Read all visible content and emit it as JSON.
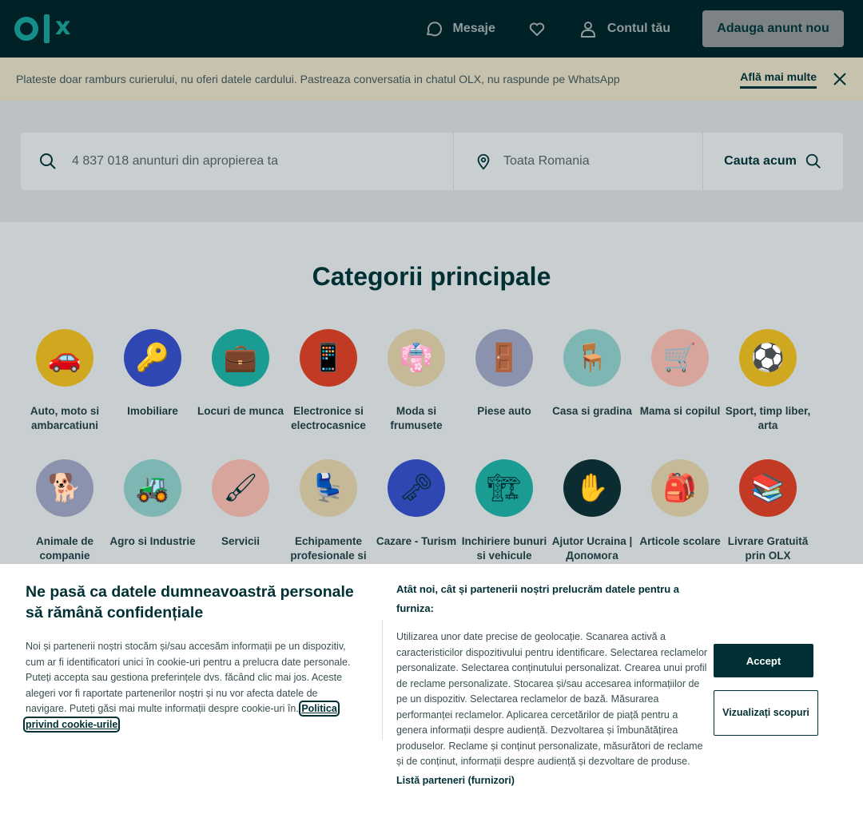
{
  "header": {
    "messages_label": "Mesaje",
    "account_label": "Contul tău",
    "post_ad_label": "Adauga anunt nou"
  },
  "banner": {
    "text": "Plateste doar ramburs curierului, nu oferi datele cardului. Pastreaza conversatia in chatul OLX, nu raspunde pe WhatsApp",
    "link": "Află mai multe"
  },
  "search": {
    "placeholder": "4 837 018 anunturi din apropierea ta",
    "location": "Toata Romania",
    "button": "Cauta acum"
  },
  "categories": {
    "title": "Categorii principale",
    "items": [
      {
        "label": "Auto, moto si ambarcatiuni",
        "color": "#cfa81f",
        "icon": "🚗"
      },
      {
        "label": "Imobiliare",
        "color": "#2f47b3",
        "icon": "🔑"
      },
      {
        "label": "Locuri de munca",
        "color": "#1b9c92",
        "icon": "💼"
      },
      {
        "label": "Electronice si electrocasnice",
        "color": "#c23a23",
        "icon": "📱"
      },
      {
        "label": "Moda si frumusete",
        "color": "#c6b997",
        "icon": "👘"
      },
      {
        "label": "Piese auto",
        "color": "#8b92ad",
        "icon": "🚪"
      },
      {
        "label": "Casa si gradina",
        "color": "#7eb6b4",
        "icon": "🪑"
      },
      {
        "label": "Mama si copilul",
        "color": "#d7a59b",
        "icon": "🛒"
      },
      {
        "label": "Sport, timp liber, arta",
        "color": "#cfa81f",
        "icon": "⚽"
      },
      {
        "label": "Animale de companie",
        "color": "#8b92ad",
        "icon": "🐕"
      },
      {
        "label": "Agro si Industrie",
        "color": "#7eb6b4",
        "icon": "🚜"
      },
      {
        "label": "Servicii",
        "color": "#d7a59b",
        "icon": "🖌"
      },
      {
        "label": "Echipamente profesionale si",
        "color": "#c6b997",
        "icon": "💺"
      },
      {
        "label": "Cazare - Turism",
        "color": "#2f47b3",
        "icon": "🗝"
      },
      {
        "label": "Inchiriere bunuri si vehicule",
        "color": "#1b9c92",
        "icon": "🏗"
      },
      {
        "label": "Ajutor Ucraina | Допомога",
        "color": "#0b2d31",
        "icon": "✋"
      },
      {
        "label": "Articole scolare",
        "color": "#c6b997",
        "icon": "🎒"
      },
      {
        "label": "Livrare Gratuită prin OLX",
        "color": "#c23a23",
        "icon": "📚"
      }
    ]
  },
  "cookie": {
    "title": "Ne pasă ca datele dumneavoastră personale să rămână confidențiale",
    "text": "Noi și partenerii noștri stocăm și/sau accesăm informații pe un dispozitiv, cum ar fi identificatori unici în cookie-uri pentru a prelucra date personale. Puteți accepta sau gestiona preferințele dvs. făcând clic mai jos. Aceste alegeri vor fi raportate partenerilor noștri și nu vor afecta datele de navigare. Puteți găsi mai multe informații despre cookie-uri în.",
    "policy_link": "Politica privind cookie-urile",
    "mid_title": "Atât noi, cât și partenerii noștri prelucrăm datele pentru a furniza:",
    "mid_text": "Utilizarea unor date precise de geolocație. Scanarea activă a caracteristicilor dispozitivului pentru identificare. Selectarea reclamelor personalizate. Selectarea conținutului personalizat. Crearea unui profil de reclame personalizate. Stocarea și/sau accesarea informațiilor de pe un dispozitiv. Selectarea reclamelor de bază. Măsurarea performanței reclamelor. Aplicarea cercetărilor de piață pentru a genera informații despre audiență. Dezvoltarea și îmbunătățirea produselor. Reclame și conținut personalizate, măsurători de reclame și de conținut, informații despre audiență și dezvoltare de produse.",
    "partners_link": "Listă parteneri (furnizori)",
    "accept_label": "Accept",
    "view_label": "Vizualizați scopuri"
  }
}
